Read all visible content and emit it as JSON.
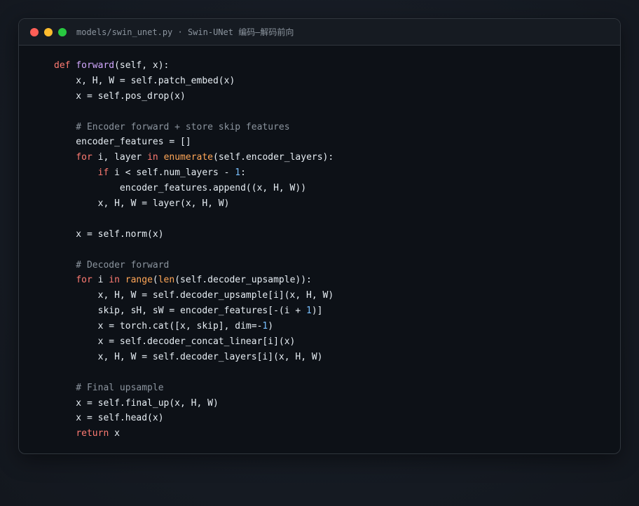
{
  "window": {
    "title": "models/swin_unet.py · Swin-UNet 编码—解码前向"
  },
  "code_lines": [
    [
      [
        "kw",
        "def "
      ],
      [
        "fn",
        "forward"
      ],
      [
        "tx",
        "(self, x):"
      ]
    ],
    [
      [
        "tx",
        "    x, H, W = self.patch_embed(x)"
      ]
    ],
    [
      [
        "tx",
        "    x = self.pos_drop(x)"
      ]
    ],
    [],
    [
      [
        "cm",
        "    # Encoder forward + store skip features"
      ]
    ],
    [
      [
        "tx",
        "    encoder_features = []"
      ]
    ],
    [
      [
        "tx",
        "    "
      ],
      [
        "kw",
        "for"
      ],
      [
        "tx",
        " i, layer "
      ],
      [
        "kw",
        "in"
      ],
      [
        "tx",
        " "
      ],
      [
        "bi",
        "enumerate"
      ],
      [
        "tx",
        "(self.encoder_layers):"
      ]
    ],
    [
      [
        "tx",
        "        "
      ],
      [
        "kw",
        "if"
      ],
      [
        "tx",
        " i < self.num_layers - "
      ],
      [
        "num",
        "1"
      ],
      [
        "tx",
        ":"
      ]
    ],
    [
      [
        "tx",
        "            encoder_features.append((x, H, W))"
      ]
    ],
    [
      [
        "tx",
        "        x, H, W = layer(x, H, W)"
      ]
    ],
    [],
    [
      [
        "tx",
        "    x = self.norm(x)"
      ]
    ],
    [],
    [
      [
        "cm",
        "    # Decoder forward"
      ]
    ],
    [
      [
        "tx",
        "    "
      ],
      [
        "kw",
        "for"
      ],
      [
        "tx",
        " i "
      ],
      [
        "kw",
        "in"
      ],
      [
        "tx",
        " "
      ],
      [
        "bi",
        "range"
      ],
      [
        "tx",
        "("
      ],
      [
        "bi",
        "len"
      ],
      [
        "tx",
        "(self.decoder_upsample)):"
      ]
    ],
    [
      [
        "tx",
        "        x, H, W = self.decoder_upsample[i](x, H, W)"
      ]
    ],
    [
      [
        "tx",
        "        skip, sH, sW = encoder_features[-(i + "
      ],
      [
        "num",
        "1"
      ],
      [
        "tx",
        ")]"
      ]
    ],
    [
      [
        "tx",
        "        x = torch.cat([x, skip], dim=-"
      ],
      [
        "num",
        "1"
      ],
      [
        "tx",
        ")"
      ]
    ],
    [
      [
        "tx",
        "        x = self.decoder_concat_linear[i](x)"
      ]
    ],
    [
      [
        "tx",
        "        x, H, W = self.decoder_layers[i](x, H, W)"
      ]
    ],
    [],
    [
      [
        "cm",
        "    # Final upsample"
      ]
    ],
    [
      [
        "tx",
        "    x = self.final_up(x, H, W)"
      ]
    ],
    [
      [
        "tx",
        "    x = self.head(x)"
      ]
    ],
    [
      [
        "tx",
        "    "
      ],
      [
        "kw",
        "return"
      ],
      [
        "tx",
        " x"
      ]
    ]
  ],
  "colors": {
    "keyword": "#ff7b72",
    "function": "#d2a8ff",
    "builtin": "#ffa657",
    "number": "#79c0ff",
    "comment": "#8b949e",
    "text": "#e6edf3"
  }
}
